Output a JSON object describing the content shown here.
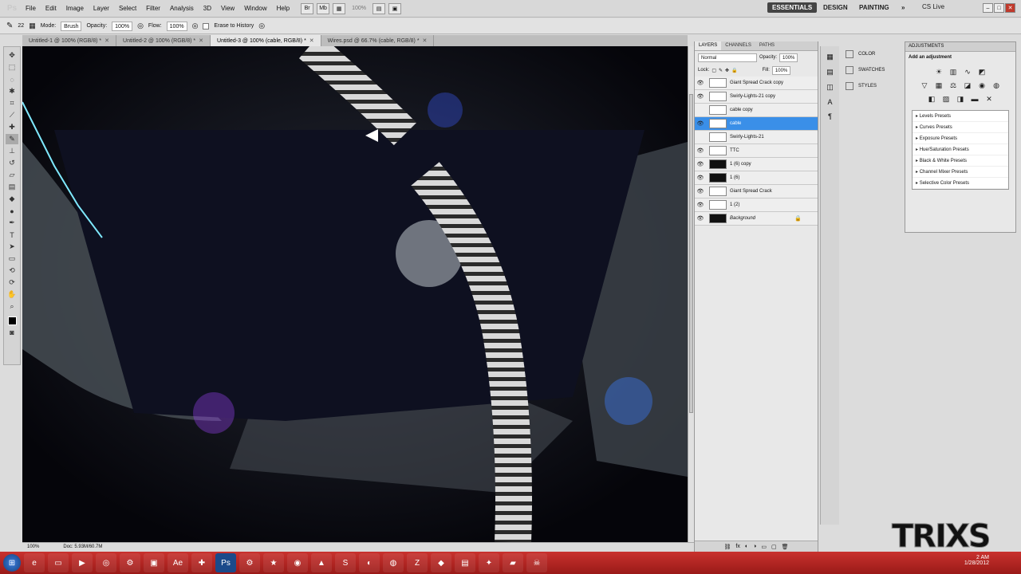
{
  "app": {
    "logo": "Ps"
  },
  "menubar": {
    "items": [
      "File",
      "Edit",
      "Image",
      "Layer",
      "Select",
      "Filter",
      "Analysis",
      "3D",
      "View",
      "Window",
      "Help"
    ],
    "zoom": "100%",
    "workspaces": [
      "ESSENTIALS",
      "DESIGN",
      "PAINTING",
      "»"
    ],
    "cs_live": "CS Live"
  },
  "options": {
    "brush_size": "22",
    "mode_label": "Mode:",
    "mode_value": "Brush",
    "opacity_label": "Opacity:",
    "opacity_value": "100%",
    "flow_label": "Flow:",
    "flow_value": "100%",
    "erase_label": "Erase to History"
  },
  "doc_tabs": [
    "Untitled-1 @ 100% (RGB/8) *",
    "Untitled-2 @ 100% (RGB/8) *",
    "Untitled-3 @ 100% (cable, RGB/8) *",
    "Wires.psd @ 66.7% (cable, RGB/8) *"
  ],
  "status": {
    "zoom": "100%",
    "doc": "Doc: 5.93M/60.7M"
  },
  "layers_panel": {
    "tabs": [
      "LAYERS",
      "CHANNELS",
      "PATHS"
    ],
    "blend_mode": "Normal",
    "opacity_label": "Opacity:",
    "opacity_value": "100%",
    "lock_label": "Lock:",
    "fill_label": "Fill:",
    "fill_value": "100%",
    "layers": [
      "Giant Spread Crack copy",
      "Swirly-Lights-21 copy",
      "cable copy",
      "cable",
      "Swirly-Lights-21",
      "TTC",
      "1 (6) copy",
      "1 (6)",
      "Giant Spread Crack",
      "1 (2)",
      "Background"
    ],
    "selected_layer": "cable"
  },
  "color_panel": {
    "items": [
      "COLOR",
      "SWATCHES",
      "STYLES"
    ]
  },
  "adjustments": {
    "title": "ADJUSTMENTS",
    "subtitle": "Add an adjustment",
    "presets": [
      "Levels Presets",
      "Curves Presets",
      "Exposure Presets",
      "Hue/Saturation Presets",
      "Black & White Presets",
      "Channel Mixer Presets",
      "Selective Color Presets"
    ]
  },
  "taskbar": {
    "clock_time": "2 AM",
    "clock_date": "1/28/2012"
  },
  "watermark": "TRIXS",
  "colors": {
    "selection": "#3a8fe8",
    "taskbar": "#c9322e",
    "canvas_bg": "#05050a"
  }
}
